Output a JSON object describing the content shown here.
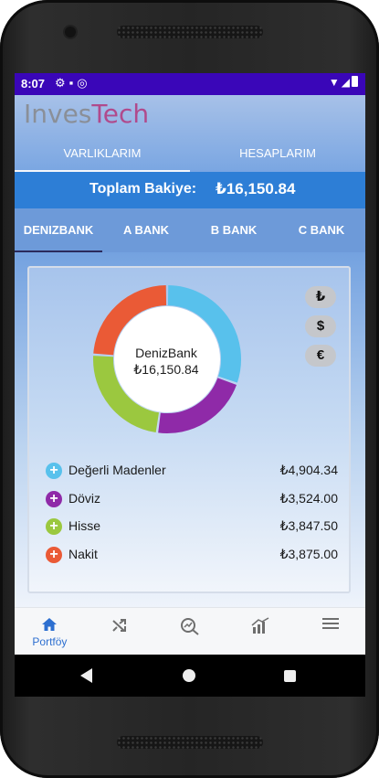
{
  "status_bar": {
    "time": "8:07",
    "left_icons": [
      "gear-icon",
      "sd-card-icon",
      "sync-icon"
    ],
    "right_icons": [
      "wifi-icon",
      "signal-icon",
      "battery-icon"
    ]
  },
  "app": {
    "logo_part1": "Inves",
    "logo_part2": "Tech"
  },
  "top_tabs": [
    {
      "label": "VARLIKLARIM",
      "active": true
    },
    {
      "label": "HESAPLARIM",
      "active": false
    }
  ],
  "total": {
    "label": "Toplam Bakiye:",
    "value": "₺16,150.84"
  },
  "bank_tabs": [
    {
      "label": "DENIZBANK",
      "active": true
    },
    {
      "label": "A BANK",
      "active": false
    },
    {
      "label": "B BANK",
      "active": false
    },
    {
      "label": "C BANK",
      "active": false
    }
  ],
  "currency_buttons": [
    {
      "symbol": "₺"
    },
    {
      "symbol": "$"
    },
    {
      "symbol": "€"
    }
  ],
  "donut": {
    "center_title": "DenizBank",
    "center_value": "₺16,150.84"
  },
  "assets": [
    {
      "label": "Değerli Madenler",
      "value": "₺4,904.34",
      "amount": 4904.34,
      "color": "#58c1ec",
      "sign": "+"
    },
    {
      "label": "Döviz",
      "value": "₺3,524.00",
      "amount": 3524.0,
      "color": "#8f2aa8",
      "sign": "+"
    },
    {
      "label": "Hisse",
      "value": "₺3,847.50",
      "amount": 3847.5,
      "color": "#9bc83f",
      "sign": "+"
    },
    {
      "label": "Nakit",
      "value": "₺3,875.00",
      "amount": 3875.0,
      "color": "#ea5a36",
      "sign": "+"
    }
  ],
  "bottom_nav": [
    {
      "label": "Portföy",
      "icon": "home-icon",
      "active": true
    },
    {
      "label": "",
      "icon": "shuffle-icon",
      "active": false
    },
    {
      "label": "",
      "icon": "search-chart-icon",
      "active": false
    },
    {
      "label": "",
      "icon": "bar-chart-icon",
      "active": false
    },
    {
      "label": "",
      "icon": "menu-icon",
      "active": false
    }
  ],
  "system_nav": [
    "back-icon",
    "home-circle-icon",
    "recents-icon"
  ]
}
